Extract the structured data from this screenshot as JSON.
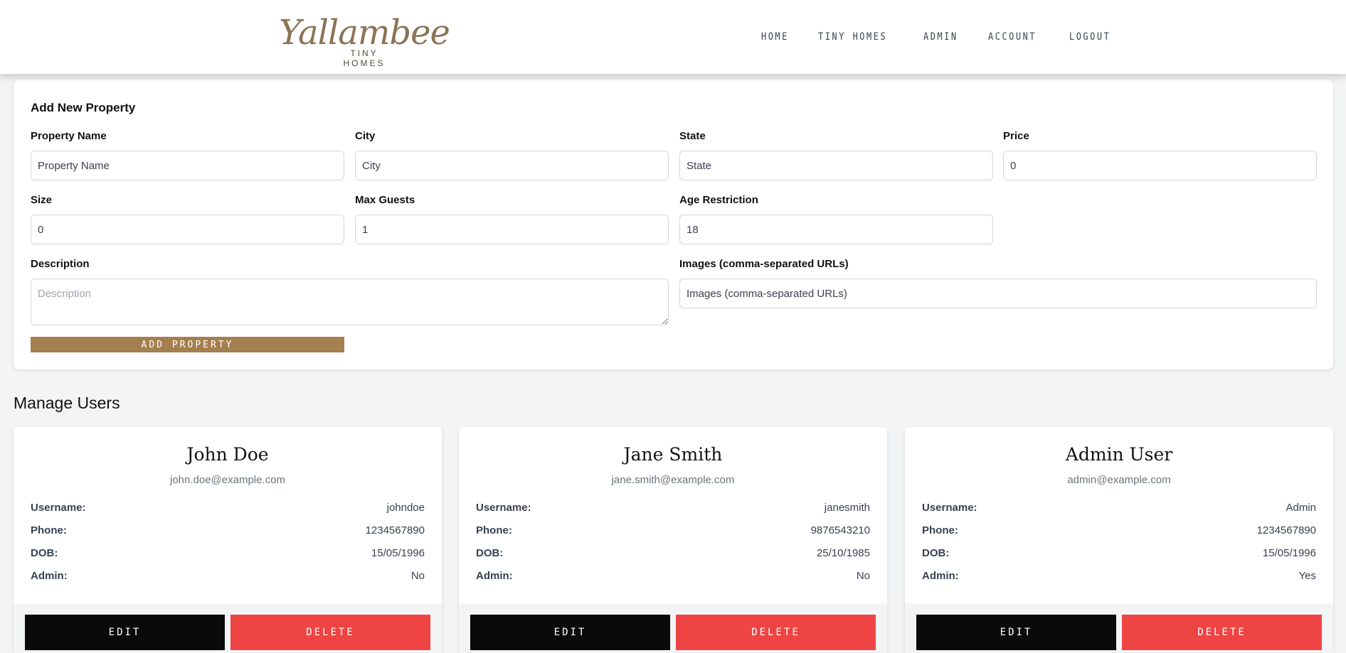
{
  "header": {
    "logo_text": "Yallambee",
    "logo_sub": "TINY HOMES",
    "nav": [
      "HOME",
      "TINY HOMES",
      "ADMIN",
      "ACCOUNT",
      "LOGOUT"
    ]
  },
  "form": {
    "title": "Add New Property",
    "fields": {
      "property_name": {
        "label": "Property Name",
        "placeholder": "Property Name",
        "value": ""
      },
      "city": {
        "label": "City",
        "placeholder": "City",
        "value": ""
      },
      "state": {
        "label": "State",
        "placeholder": "State",
        "value": ""
      },
      "price": {
        "label": "Price",
        "value": "0"
      },
      "size": {
        "label": "Size",
        "value": "0"
      },
      "max_guests": {
        "label": "Max Guests",
        "value": "1"
      },
      "age_restriction": {
        "label": "Age Restriction",
        "value": "18"
      },
      "description": {
        "label": "Description",
        "placeholder": "Description"
      },
      "images": {
        "label": "Images (comma-separated URLs)",
        "placeholder": "Images (comma-separated URLs)"
      }
    },
    "submit_label": "ADD PROPERTY"
  },
  "users_section": {
    "title": "Manage Users",
    "labels": {
      "username": "Username:",
      "phone": "Phone:",
      "dob": "DOB:",
      "admin": "Admin:"
    },
    "edit_label": "EDIT",
    "delete_label": "DELETE",
    "users": [
      {
        "name": "John Doe",
        "email": "john.doe@example.com",
        "username": "johndoe",
        "phone": "1234567890",
        "dob": "15/05/1996",
        "admin": "No"
      },
      {
        "name": "Jane Smith",
        "email": "jane.smith@example.com",
        "username": "janesmith",
        "phone": "9876543210",
        "dob": "25/10/1985",
        "admin": "No"
      },
      {
        "name": "Admin User",
        "email": "admin@example.com",
        "username": "Admin",
        "phone": "1234567890",
        "dob": "15/05/1996",
        "admin": "Yes"
      }
    ]
  },
  "colors": {
    "brand": "#a47f4f",
    "danger": "#ef4444",
    "dark": "#0a0a0a"
  }
}
